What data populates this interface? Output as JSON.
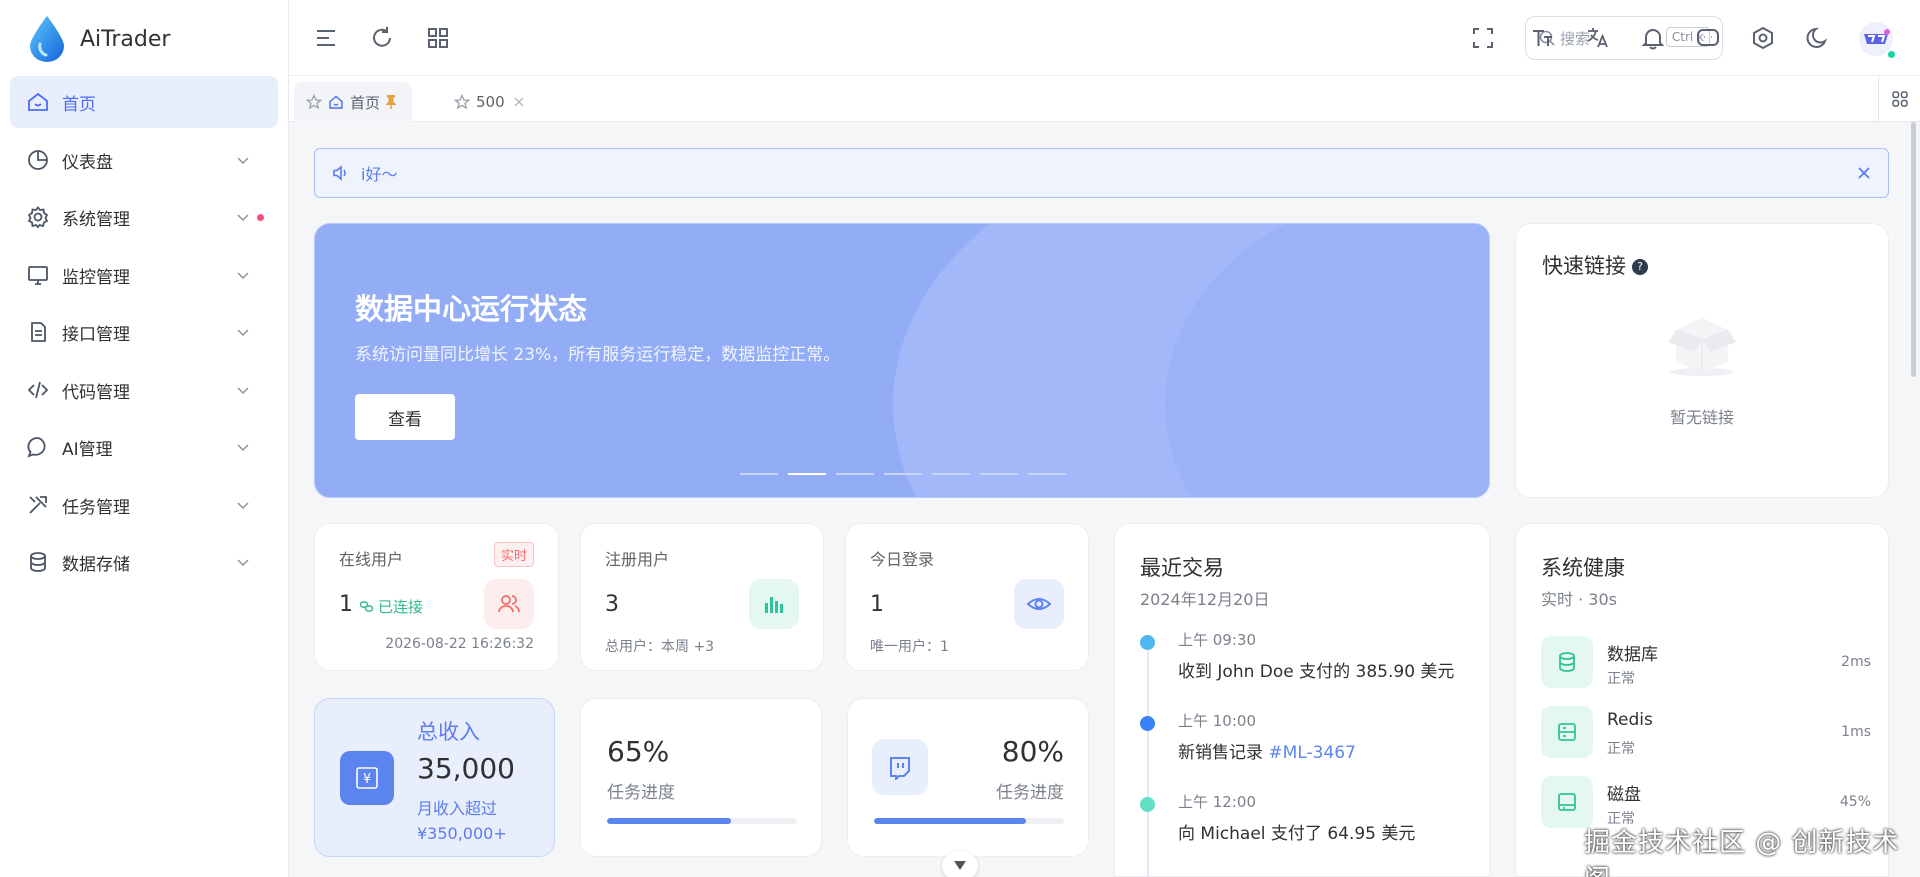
{
  "app": {
    "title": "AiTrader"
  },
  "sidebar": {
    "items": [
      {
        "label": "首页",
        "icon": "home-icon"
      },
      {
        "label": "仪表盘",
        "icon": "pie-chart-icon"
      },
      {
        "label": "系统管理",
        "icon": "gear-icon"
      },
      {
        "label": "监控管理",
        "icon": "monitor-icon"
      },
      {
        "label": "接口管理",
        "icon": "document-icon"
      },
      {
        "label": "代码管理",
        "icon": "code-icon"
      },
      {
        "label": "AI管理",
        "icon": "chat-bubble-icon"
      },
      {
        "label": "任务管理",
        "icon": "tools-icon"
      },
      {
        "label": "数据存储",
        "icon": "database-icon"
      }
    ]
  },
  "header": {
    "search_placeholder": "搜索",
    "search_shortcut": "Ctrl k"
  },
  "tabs": [
    {
      "label": "首页"
    },
    {
      "label": "500"
    }
  ],
  "notice": {
    "text": "i好～"
  },
  "banner": {
    "title": "数据中心运行状态",
    "subtitle": "系统访问量同比增长 23%，所有服务运行稳定，数据监控正常。",
    "button": "查看",
    "active_slide": 2,
    "slide_count": 7
  },
  "quick_links": {
    "title": "快速链接",
    "help": "?",
    "empty": "暂无链接"
  },
  "stats": {
    "online": {
      "title": "在线用户",
      "badge": "实时",
      "value": "1",
      "status": "已连接",
      "timestamp": "2026-08-22 16:26:32"
    },
    "registered": {
      "title": "注册用户",
      "value": "3",
      "foot": "总用户：本周 +3"
    },
    "login": {
      "title": "今日登录",
      "value": "1",
      "foot": "唯一用户：1"
    }
  },
  "revenue": {
    "icon_symbol": "¥",
    "title": "总收入",
    "value": "35,000",
    "sub1": "月收入超过",
    "sub2": "¥350,000+"
  },
  "progress1": {
    "value": "65%",
    "label": "任务进度",
    "fraction": 0.65
  },
  "progress2": {
    "value": "80%",
    "label": "任务进度",
    "fraction": 0.8
  },
  "transactions": {
    "title": "最近交易",
    "date": "2024年12月20日",
    "items": [
      {
        "time": "上午 09:30",
        "text": "收到 John Doe 支付的 385.90 美元",
        "color": "#4fb9ef"
      },
      {
        "time": "上午 10:00",
        "text": "新销售记录 ",
        "link": "#ML-3467",
        "color": "#3b82f6"
      },
      {
        "time": "上午 12:00",
        "text": "向 Michael 支付了 64.95 美元",
        "color": "#5fe0c4"
      }
    ]
  },
  "health": {
    "title": "系统健康",
    "subtitle": "实时 · 30s",
    "items": [
      {
        "name": "数据库",
        "status": "正常",
        "value": "2ms"
      },
      {
        "name": "Redis",
        "status": "正常",
        "value": "1ms"
      },
      {
        "name": "磁盘",
        "status": "正常",
        "value": "45%"
      }
    ]
  },
  "watermark": "掘金技术社区 @ 创新技术阁",
  "colors": {
    "accent": "#5c84f0",
    "banner": "#93acf6",
    "success": "#2fc39a",
    "danger": "#f56c6c"
  }
}
